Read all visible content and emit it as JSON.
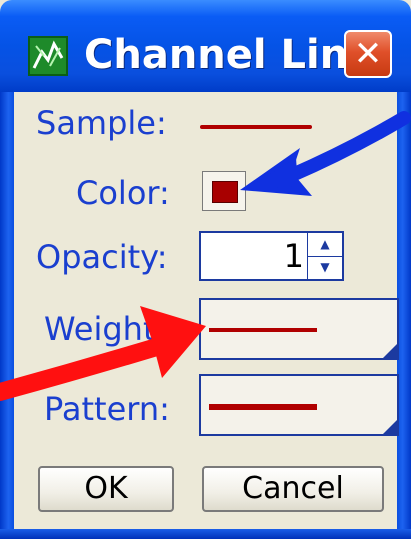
{
  "window": {
    "title": "Channel Lin...",
    "close_glyph": "✕",
    "app_icon": "channel-app-icon"
  },
  "form": {
    "sample_label": "Sample:",
    "color_label": "Color:",
    "opacity_label": "Opacity:",
    "opacity_value": "1",
    "weight_label": "Weight:",
    "pattern_label": "Pattern:"
  },
  "buttons": {
    "ok": "OK",
    "cancel": "Cancel"
  },
  "colors": {
    "line_color": "#b00000",
    "swatch_color": "#a80000",
    "label_color": "#1a3fcf",
    "annotation_blue": "#1030e0",
    "annotation_red": "#ff0000"
  },
  "icons": {
    "spin_up": "▲",
    "spin_down": "▼"
  }
}
